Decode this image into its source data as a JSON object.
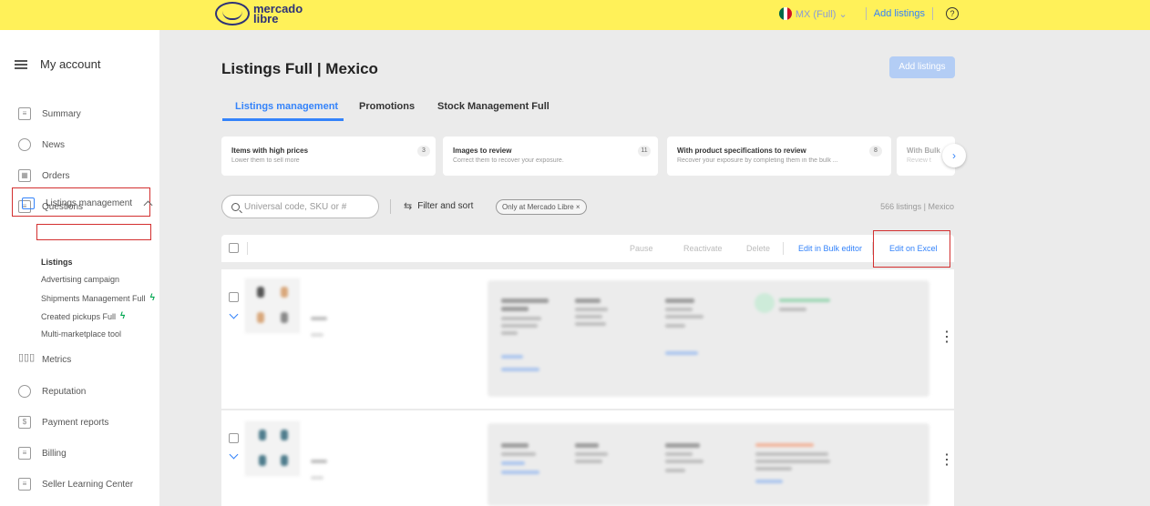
{
  "header": {
    "logo_text": "mercado libre",
    "country": "MX (Full) ⌄",
    "add_listings_link": "Add listings",
    "help_icon_glyph": "?",
    "colors": {
      "background": "#fff159",
      "brand_text": "#2d3277",
      "link": "#3483fa"
    }
  },
  "sidebar": {
    "my_account": "My account",
    "items": [
      {
        "label": "Summary",
        "icon": "summary-icon"
      },
      {
        "label": "News",
        "icon": "bell-icon"
      },
      {
        "label": "Orders",
        "icon": "orders-icon"
      },
      {
        "label": "Questions",
        "icon": "questions-icon"
      },
      {
        "label": "Listings management",
        "icon": "listings-icon"
      },
      {
        "label": "Metrics",
        "icon": "metrics-icon"
      },
      {
        "label": "Reputation",
        "icon": "reputation-icon"
      },
      {
        "label": "Payment reports",
        "icon": "payment-icon"
      },
      {
        "label": "Billing",
        "icon": "billing-icon"
      },
      {
        "label": "Seller Learning Center",
        "icon": "learning-icon"
      }
    ],
    "sub_items": [
      {
        "label": "Listings"
      },
      {
        "label": "Advertising campaign"
      },
      {
        "label": "Shipments Management Full"
      },
      {
        "label": "Created pickups Full"
      },
      {
        "label": "Multi-marketplace tool"
      }
    ]
  },
  "main": {
    "title": "Listings Full | Mexico",
    "add_button": "Add listings",
    "tabs": [
      {
        "label": "Listings management",
        "active": true
      },
      {
        "label": "Promotions",
        "active": false
      },
      {
        "label": "Stock Management Full",
        "active": false
      }
    ],
    "cards": [
      {
        "title": "Items with high prices",
        "subtitle": "Lower them to sell more",
        "count": "3"
      },
      {
        "title": "Images to review",
        "subtitle": "Correct them to recover your exposure.",
        "count": "11"
      },
      {
        "title": "With product specifications to review",
        "subtitle": "Recover your exposure by completing them in the bulk ...",
        "count": "8"
      },
      {
        "title": "With Bulk",
        "subtitle": "Review t"
      }
    ],
    "next_glyph": "›",
    "search": {
      "placeholder": "Universal code, SKU or #"
    },
    "filter_label": "Filter and sort",
    "filter_glyph": "⇆",
    "chip_label": "Only at Mercado Libre ×",
    "count_text": "566 listings | Mexico",
    "actions": {
      "pause": "Pause",
      "reactivate": "Reactivate",
      "delete": "Delete",
      "bulk_editor": "Edit in Bulk editor",
      "excel": "Edit on Excel"
    },
    "menu_glyph": "⋮",
    "highlight_color": "#d32f2f"
  }
}
